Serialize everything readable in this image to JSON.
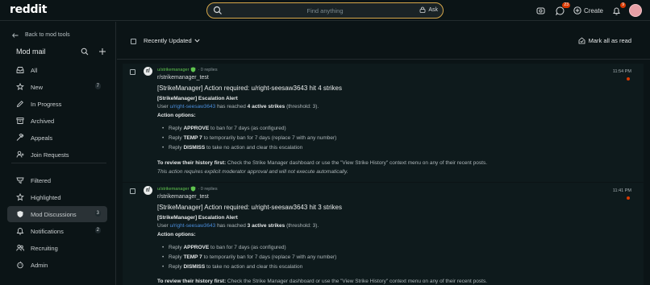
{
  "header": {
    "logo": "reddit",
    "search_placeholder": "Find anything",
    "ask_label": "Ask",
    "chat_badge": "23",
    "notif_badge": "9",
    "create_label": "Create"
  },
  "sidebar": {
    "back_label": "Back to mod tools",
    "title": "Mod mail",
    "items": [
      {
        "label": "All",
        "icon": "inbox-icon",
        "count": ""
      },
      {
        "label": "New",
        "icon": "new-icon",
        "count": "7"
      },
      {
        "label": "In Progress",
        "icon": "pencil-icon",
        "count": ""
      },
      {
        "label": "Archived",
        "icon": "archive-icon",
        "count": ""
      },
      {
        "label": "Appeals",
        "icon": "appeals-icon",
        "count": ""
      },
      {
        "label": "Join Requests",
        "icon": "join-requests-icon",
        "count": ""
      },
      {
        "label": "Filtered",
        "icon": "filtered-icon",
        "count": ""
      },
      {
        "label": "Highlighted",
        "icon": "star-icon",
        "count": ""
      },
      {
        "label": "Mod Discussions",
        "icon": "shield-icon",
        "count": "3"
      },
      {
        "label": "Notifications",
        "icon": "bell-icon",
        "count": "2"
      },
      {
        "label": "Recruiting",
        "icon": "recruiting-icon",
        "count": ""
      },
      {
        "label": "Admin",
        "icon": "admin-icon",
        "count": ""
      }
    ]
  },
  "main": {
    "sort_label": "Recently Updated",
    "mark_all_label": "Mark all as read",
    "threads": [
      {
        "author": "u/strikemanager",
        "replies": "· 0 replies",
        "subreddit": "r/strikemanager_test",
        "time": "11:54 PM",
        "subject": "[StrikeManager] Action required: u/right-seesaw3643 hit 4 strikes",
        "alert_title": "[StrikeManager] Escalation Alert",
        "user_prefix": "User ",
        "user_link": "u/right-seesaw3643",
        "user_mid": " has reached ",
        "user_strikes": "4 active strikes",
        "user_suffix": " (threshold: 3).",
        "options_title": "Action options:",
        "options": [
          {
            "pre": "Reply ",
            "kw": "APPROVE",
            "post": " to ban for 7 days (as configured)"
          },
          {
            "pre": "Reply ",
            "kw": "TEMP 7",
            "post": " to temporarily ban for 7 days (replace 7 with any number)"
          },
          {
            "pre": "Reply ",
            "kw": "DISMISS",
            "post": " to take no action and clear this escalation"
          }
        ],
        "review_title": "To review their history first:",
        "review_text": " Check the Strike Manager dashboard or use the \"View Strike History\" context menu on any of their recent posts.",
        "approval_note": "This action requires explicit moderator approval and will not execute automatically."
      },
      {
        "author": "u/strikemanager",
        "replies": "· 0 replies",
        "subreddit": "r/strikemanager_test",
        "time": "11:41 PM",
        "subject": "[StrikeManager] Action required: u/right-seesaw3643 hit 3 strikes",
        "alert_title": "[StrikeManager] Escalation Alert",
        "user_prefix": "User ",
        "user_link": "u/right-seesaw3643",
        "user_mid": " has reached ",
        "user_strikes": "3 active strikes",
        "user_suffix": " (threshold: 3).",
        "options_title": "Action options:",
        "options": [
          {
            "pre": "Reply ",
            "kw": "APPROVE",
            "post": " to ban for 7 days (as configured)"
          },
          {
            "pre": "Reply ",
            "kw": "TEMP 7",
            "post": " to temporarily ban for 7 days (replace 7 with any number)"
          },
          {
            "pre": "Reply ",
            "kw": "DISMISS",
            "post": " to take no action and clear this escalation"
          }
        ],
        "review_title": "To review their history first:",
        "review_text": " Check the Strike Manager dashboard or use the \"View Strike History\" context menu on any of their recent posts."
      }
    ]
  },
  "colors": {
    "background": "#0b1416",
    "accent_orange": "#d93900",
    "link_blue": "#4a8cd9",
    "author_green": "#5fc44e",
    "search_border": "#d7a84a"
  }
}
